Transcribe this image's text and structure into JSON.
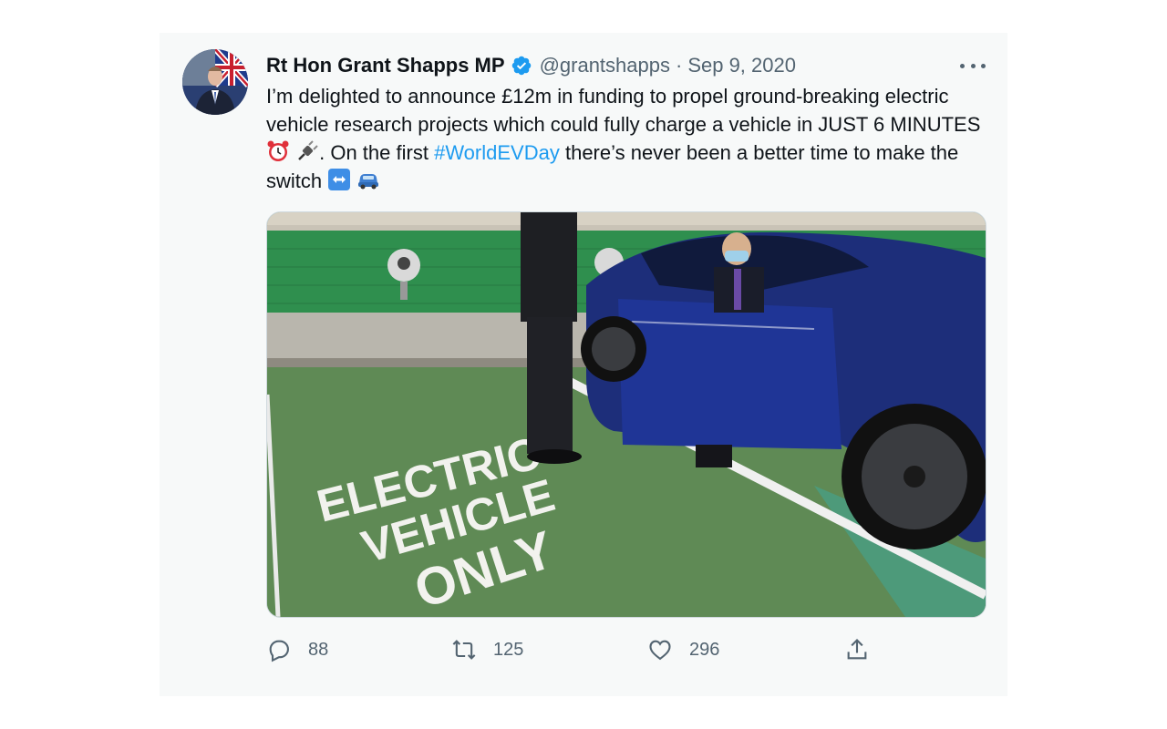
{
  "tweet": {
    "author_name": "Rt Hon Grant Shapps MP",
    "handle": "@grantshapps",
    "separator": "·",
    "date": "Sep 9, 2020",
    "text_part1": "I’m delighted to announce £12m in funding to propel ground-breaking electric vehicle research projects which could fully charge a vehicle in JUST 6 MINUTES",
    "text_part2": ". On the first",
    "hashtag": "#WorldEVDay",
    "text_part3": "there’s never been a better time to make the switch",
    "emojis": [
      "alarm-clock",
      "electric-plug",
      "left-right-arrow",
      "automobile"
    ],
    "image_text": [
      "ELECTRIC",
      "VEHICLE",
      "ONLY"
    ]
  },
  "actions": {
    "replies": "88",
    "retweets": "125",
    "likes": "296"
  },
  "colors": {
    "link": "#1d9bf0",
    "secondary_text": "#536471",
    "verified": "#1d9bf0",
    "card_bg": "#f7f9f9"
  }
}
